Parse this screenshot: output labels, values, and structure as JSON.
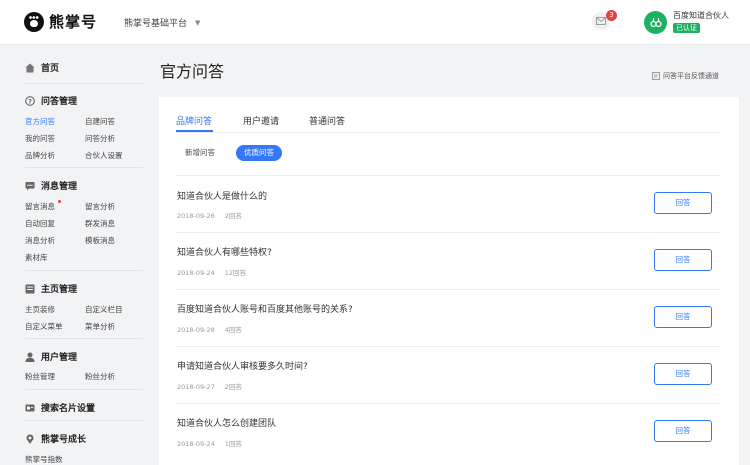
{
  "header": {
    "logo_text": "熊掌号",
    "platform_label": "熊掌号基础平台",
    "mail_badge": "3",
    "user_name": "百度知道合伙人",
    "verified_label": "已认证"
  },
  "sidebar": {
    "home_label": "首页",
    "sections": [
      {
        "title": "问答管理",
        "icon": "qa-icon",
        "items": [
          "官方问答",
          "自建问答",
          "我的问答",
          "问答分析",
          "品牌分析",
          "合伙人设置"
        ]
      },
      {
        "title": "消息管理",
        "icon": "message-icon",
        "items": [
          "留言消息",
          "留言分析",
          "自动回复",
          "群发消息",
          "消息分析",
          "模板消息",
          "素材库"
        ]
      },
      {
        "title": "主页管理",
        "icon": "homepage-icon",
        "items": [
          "主页装修",
          "自定义栏目",
          "自定义菜单",
          "菜单分析"
        ]
      },
      {
        "title": "用户管理",
        "icon": "user-icon",
        "items": [
          "粉丝管理",
          "粉丝分析"
        ]
      },
      {
        "title": "搜索名片设置",
        "icon": "card-icon",
        "items": []
      },
      {
        "title": "熊掌号成长",
        "icon": "growth-icon",
        "items": [
          "熊掌号指数"
        ]
      }
    ],
    "active_item": "官方问答",
    "unread_item": "留言消息"
  },
  "main": {
    "title": "官方问答",
    "feedback_label": "问答平台反馈通道",
    "tabs": [
      "品牌问答",
      "用户邀请",
      "普通问答"
    ],
    "active_tab": "品牌问答",
    "filters": [
      "新增问答",
      "优质问答"
    ],
    "active_filter": "优质问答",
    "answer_label": "回答",
    "questions": [
      {
        "title": "知道合伙人是做什么的",
        "date": "2018-09-26",
        "answers": "2回答"
      },
      {
        "title": "知道合伙人有哪些特权?",
        "date": "2018-09-24",
        "answers": "12回答"
      },
      {
        "title": "百度知道合伙人账号和百度其他账号的关系?",
        "date": "2018-09-28",
        "answers": "4回答"
      },
      {
        "title": "申请知道合伙人审核要多久时间?",
        "date": "2018-09-27",
        "answers": "2回答"
      },
      {
        "title": "知道合伙人怎么创建团队",
        "date": "2018-09-24",
        "answers": "1回答"
      }
    ]
  },
  "colors": {
    "accent": "#3478f6",
    "badge": "#e64340",
    "verified": "#1fb15f"
  }
}
